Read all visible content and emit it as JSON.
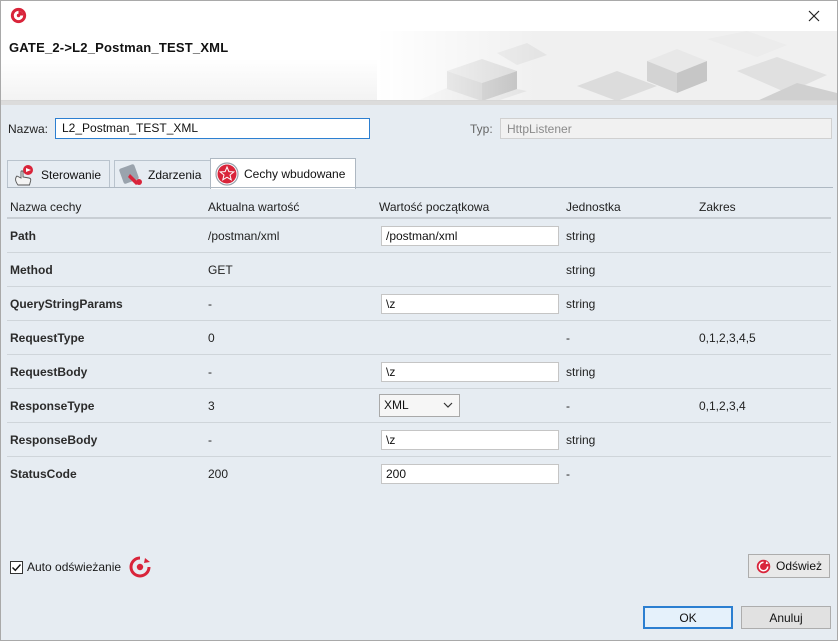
{
  "window": {
    "header_title": "GATE_2->L2_Postman_TEST_XML"
  },
  "form": {
    "name_label": "Nazwa:",
    "name_value": "L2_Postman_TEST_XML",
    "type_label": "Typ:",
    "type_value": "HttpListener"
  },
  "tabs": [
    {
      "label": "Sterowanie",
      "icon": "hand-pointer-icon",
      "active": false
    },
    {
      "label": "Zdarzenia",
      "icon": "events-icon",
      "active": false
    },
    {
      "label": "Cechy wbudowane",
      "icon": "star-icon",
      "active": true
    }
  ],
  "grid": {
    "columns": [
      "Nazwa cechy",
      "Aktualna wartość",
      "Wartość początkowa",
      "Jednostka",
      "Zakres"
    ],
    "rows": [
      {
        "name": "Path",
        "current": "/postman/xml",
        "initial": "/postman/xml",
        "unit": "string",
        "range": ""
      },
      {
        "name": "Method",
        "current": "GET",
        "initial": "",
        "unit": "string",
        "range": ""
      },
      {
        "name": "QueryStringParams",
        "current": "-",
        "initial": "\\z",
        "unit": "string",
        "range": ""
      },
      {
        "name": "RequestType",
        "current": "0",
        "initial": "",
        "unit": "-",
        "range": "0,1,2,3,4,5"
      },
      {
        "name": "RequestBody",
        "current": "-",
        "initial": "\\z",
        "unit": "string",
        "range": ""
      },
      {
        "name": "ResponseType",
        "current": "3",
        "initial": "XML",
        "unit": "-",
        "range": "0,1,2,3,4"
      },
      {
        "name": "ResponseBody",
        "current": "-",
        "initial": "\\z",
        "unit": "string",
        "range": ""
      },
      {
        "name": "StatusCode",
        "current": "200",
        "initial": "200",
        "unit": "-",
        "range": ""
      }
    ]
  },
  "footer": {
    "auto_refresh_label": "Auto odświeżanie",
    "auto_refresh_checked": true,
    "refresh_label": "Odśwież",
    "ok_label": "OK",
    "cancel_label": "Anuluj"
  },
  "colors": {
    "accent": "#2c7fd1",
    "brand_red": "#d9243a",
    "window_bg": "#e6ecf2"
  }
}
